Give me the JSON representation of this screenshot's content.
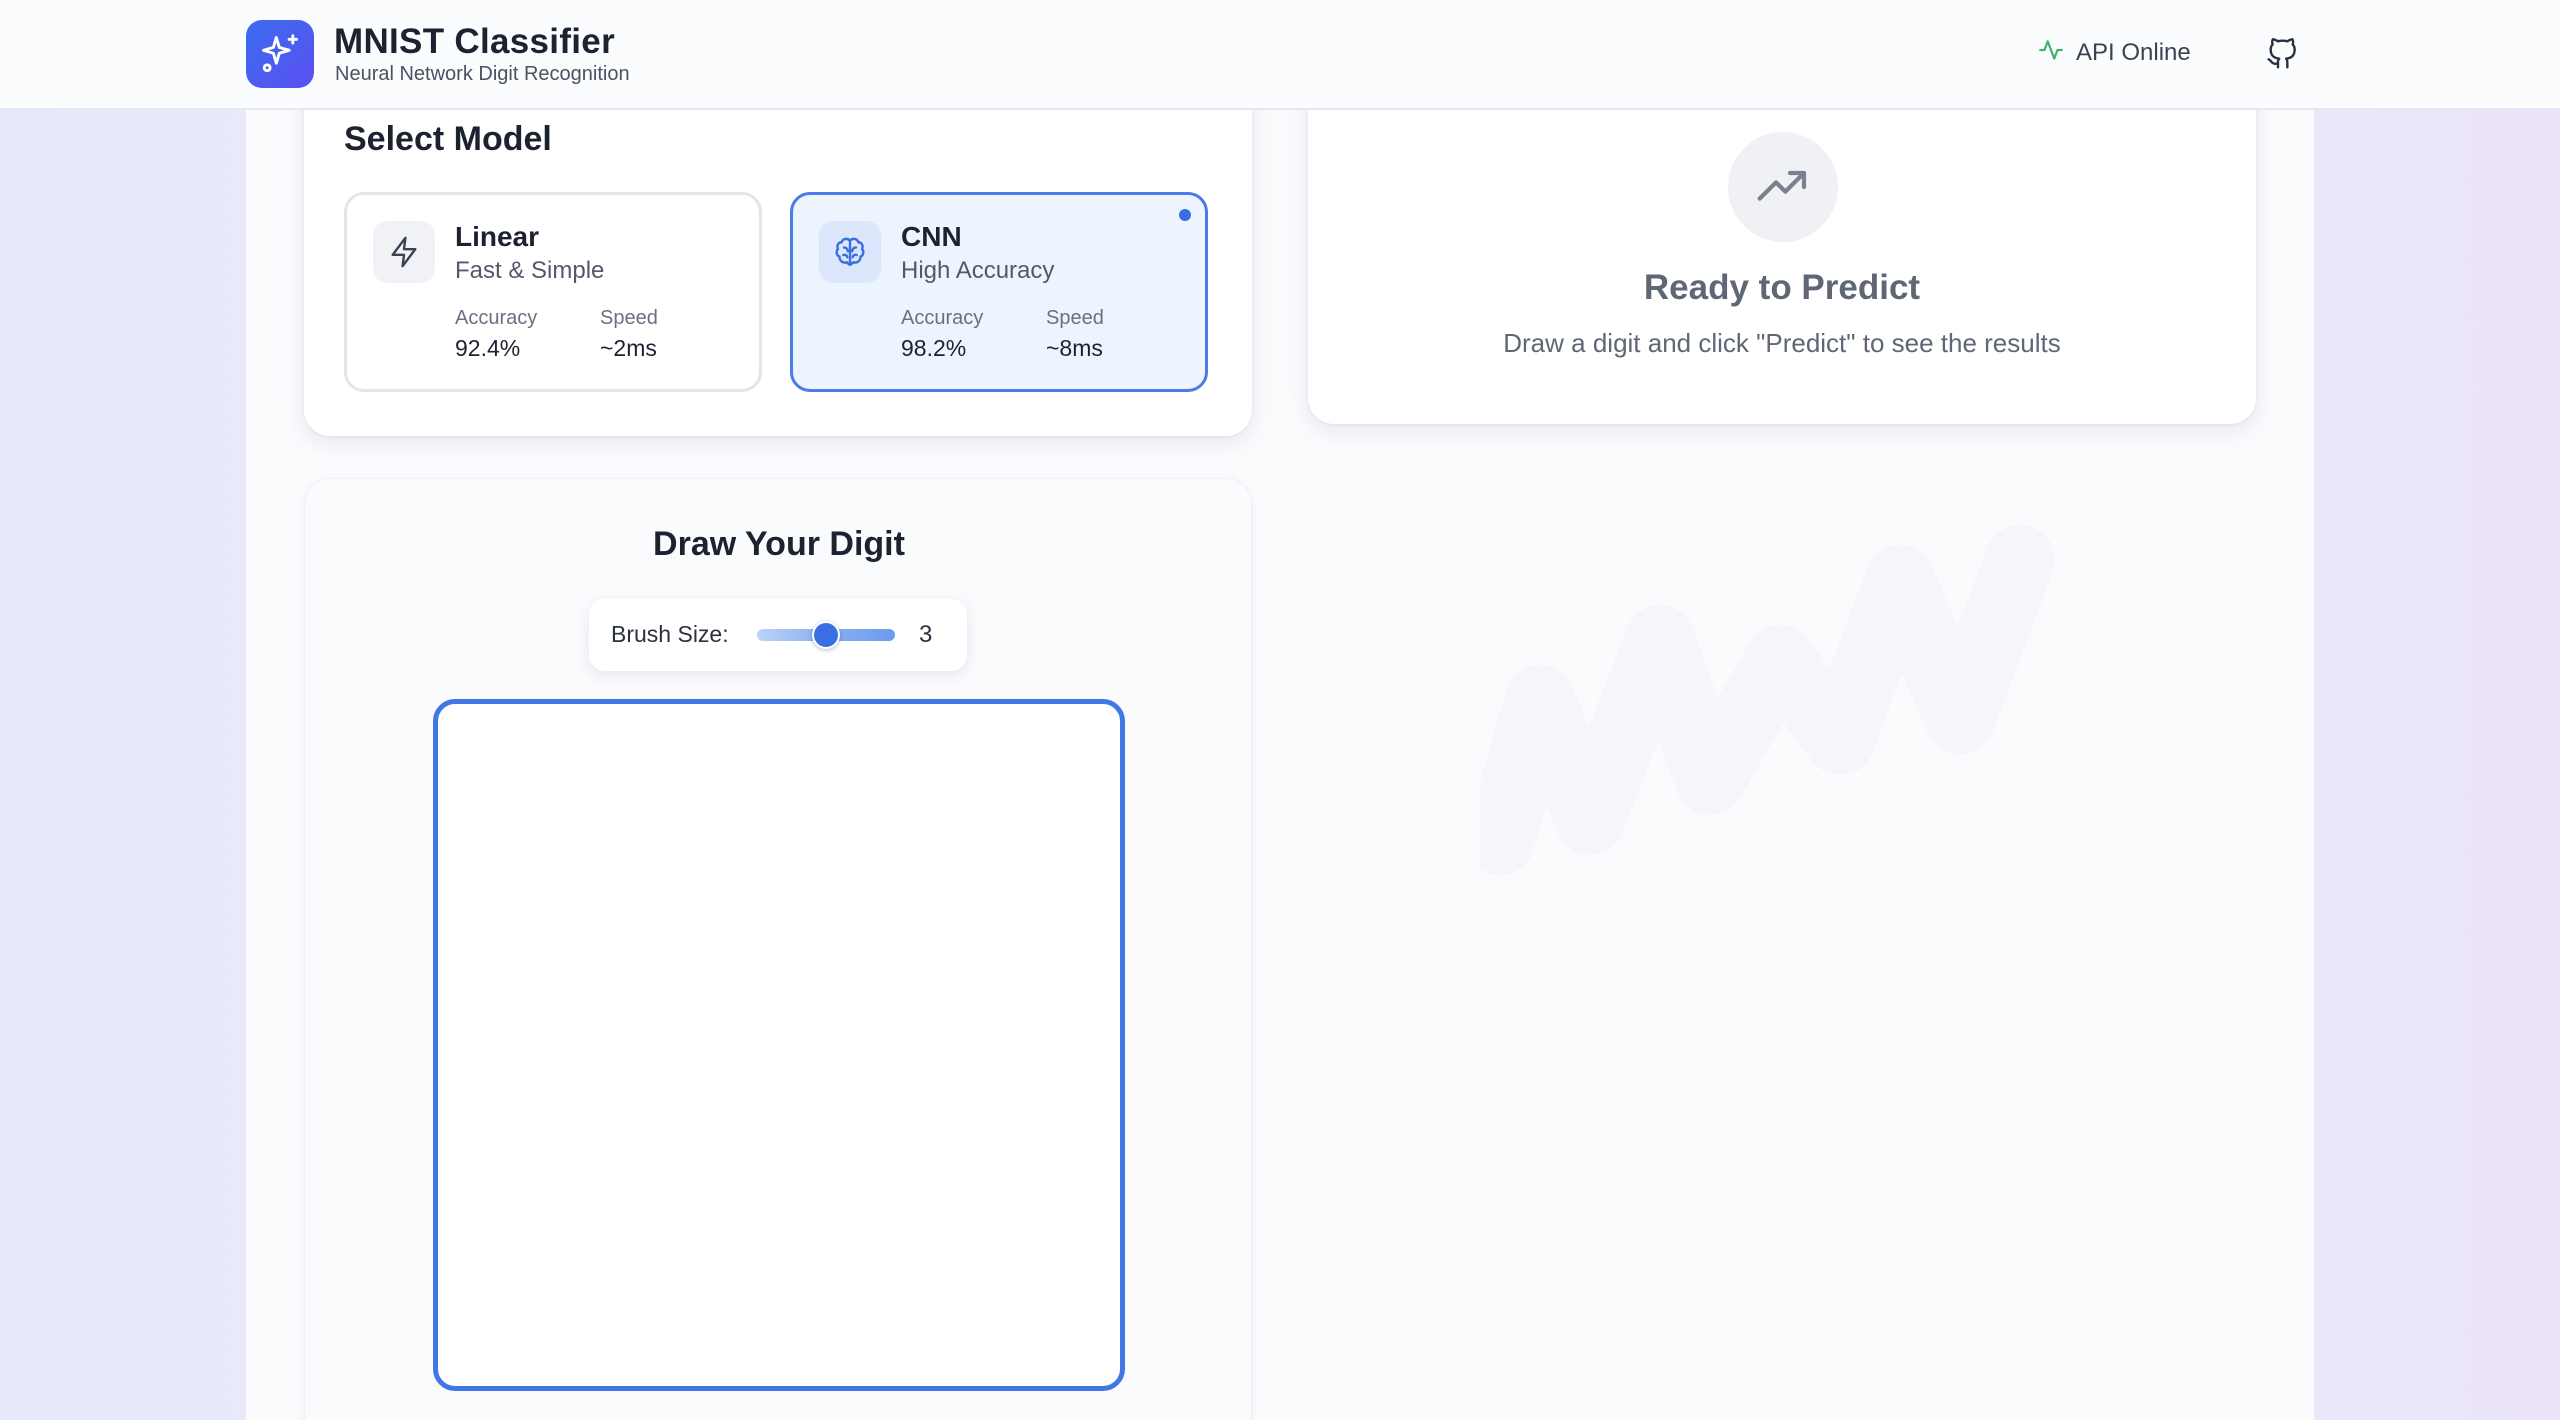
{
  "header": {
    "app_title": "MNIST Classifier",
    "app_subtitle": "Neural Network Digit Recognition",
    "api_status": "API Online",
    "api_status_color": "#3bb36a",
    "logo_icon": "sparkles-icon",
    "github_icon": "github-icon"
  },
  "model_select": {
    "title": "Select Model",
    "options": [
      {
        "name": "Linear",
        "desc": "Fast & Simple",
        "icon": "lightning-icon",
        "accuracy_label": "Accuracy",
        "accuracy": "92.4%",
        "speed_label": "Speed",
        "speed": "~2ms",
        "selected": false
      },
      {
        "name": "CNN",
        "desc": "High Accuracy",
        "icon": "brain-icon",
        "accuracy_label": "Accuracy",
        "accuracy": "98.2%",
        "speed_label": "Speed",
        "speed": "~8ms",
        "selected": true
      }
    ]
  },
  "result": {
    "icon": "trending-up-icon",
    "title": "Ready to Predict",
    "description": "Draw a digit and click \"Predict\" to see the results"
  },
  "draw": {
    "title": "Draw Your Digit",
    "brush_label": "Brush Size:",
    "brush_value": "3",
    "brush_fraction": 0.4
  },
  "colors": {
    "accent": "#3a6fe3",
    "selected_card_bg": "#eef4fe",
    "logo_gradient_start": "#3b6cf0",
    "logo_gradient_end": "#5a4ff0"
  }
}
